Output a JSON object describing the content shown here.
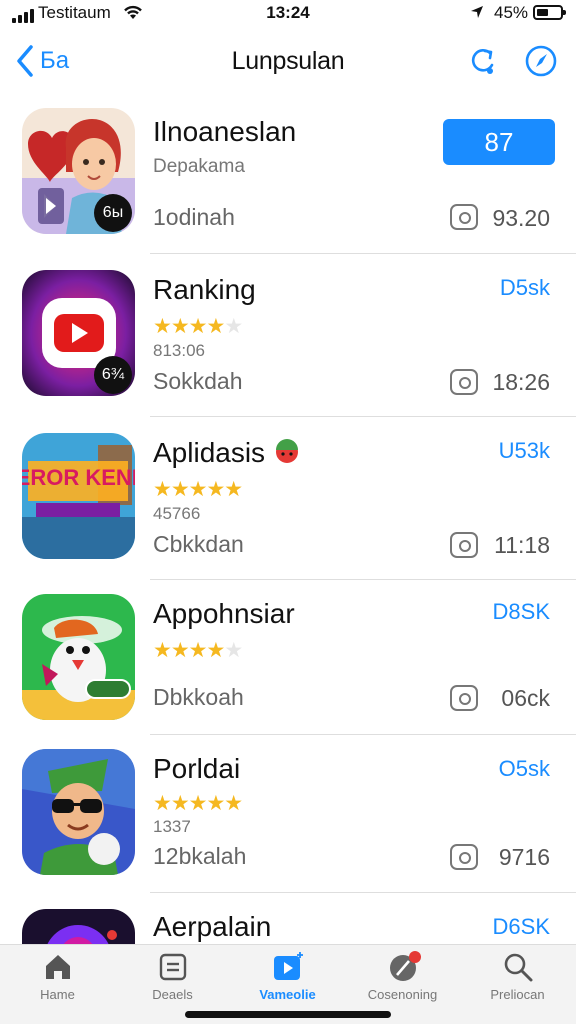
{
  "status_bar": {
    "carrier": "Testitaum",
    "time": "13:24",
    "battery": "45%",
    "battery_level": 0.45
  },
  "nav": {
    "back_label": "Ба",
    "title": "Lunpsulan"
  },
  "apps": [
    {
      "title": "Ilnoaneslan",
      "subtitle": "Depakama",
      "meta": "1odinah",
      "action_label": "87",
      "action_style": "button",
      "size": "93.20",
      "icon_badge": "6ы",
      "icon_name": "character-avatar-icon"
    },
    {
      "title": "Ranking",
      "rating": 3.5,
      "reviews": "813:06",
      "meta": "Sokkdah",
      "action_label": "D5sk",
      "action_style": "link",
      "size": "18:26",
      "icon_badge": "6¾",
      "icon_name": "video-play-icon"
    },
    {
      "title": "Aplidasis",
      "rating": 5,
      "reviews": "45766",
      "meta": "Cbkkdan",
      "action_label": "U53k",
      "action_style": "link",
      "size": "11:18",
      "icon_name": "game-banner-icon",
      "icon_text": "FEROR KENIA"
    },
    {
      "title": "Appohnsiar",
      "rating": 3.5,
      "meta": "Dbkkoah",
      "action_label": "D8SK",
      "action_style": "link",
      "size": "06ck",
      "icon_name": "cartoon-bird-icon"
    },
    {
      "title": "Porldai",
      "rating": 5,
      "reviews": "1337",
      "meta": "12bkalah",
      "action_label": "O5sk",
      "action_style": "link",
      "size": "9716",
      "icon_name": "sunglasses-character-icon"
    },
    {
      "title": "Aerpalain",
      "action_label": "D6SK",
      "action_style": "link",
      "icon_name": "purple-orb-icon"
    }
  ],
  "tabs": [
    {
      "label": "Hame",
      "icon": "home-icon"
    },
    {
      "label": "Deaels",
      "icon": "document-icon"
    },
    {
      "label": "Vameolie",
      "icon": "play-icon",
      "active": true
    },
    {
      "label": "Cosenoning",
      "icon": "dish-icon",
      "badge": true
    },
    {
      "label": "Preliocan",
      "icon": "search-icon"
    }
  ],
  "colors": {
    "accent": "#1a8cff",
    "star": "#f5b820",
    "badge": "#e53935"
  }
}
